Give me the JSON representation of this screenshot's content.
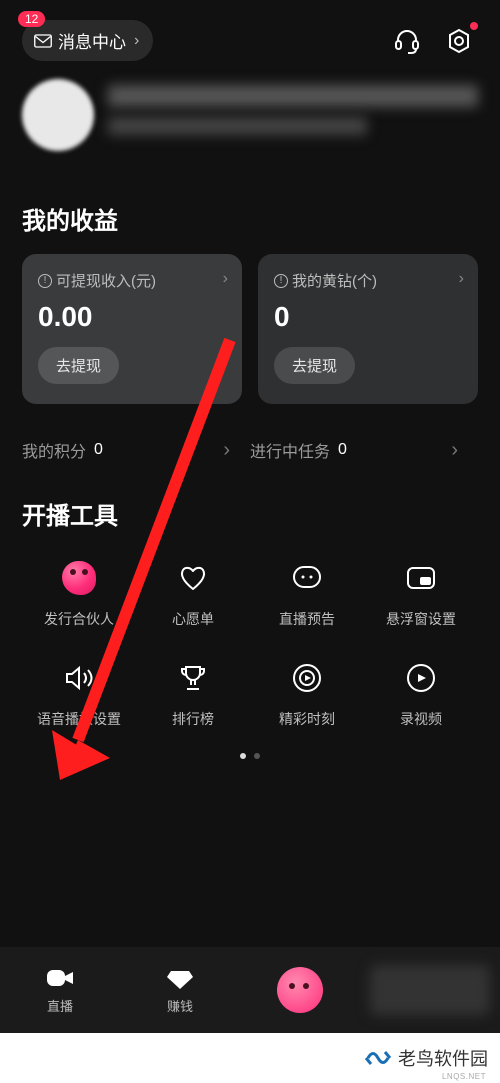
{
  "header": {
    "badge_count": "12",
    "message_center_label": "消息中心"
  },
  "earnings": {
    "title": "我的收益",
    "card1": {
      "label": "可提现收入(元)",
      "value": "0.00",
      "button": "去提现"
    },
    "card2": {
      "label": "我的黄钻(个)",
      "value": "0",
      "button": "去提现"
    },
    "stat1": {
      "label": "我的积分",
      "value": "0"
    },
    "stat2": {
      "label": "进行中任务",
      "value": "0"
    }
  },
  "tools": {
    "title": "开播工具",
    "items": [
      {
        "label": "发行合伙人"
      },
      {
        "label": "心愿单"
      },
      {
        "label": "直播预告"
      },
      {
        "label": "悬浮窗设置"
      },
      {
        "label": "语音播报设置"
      },
      {
        "label": "排行榜"
      },
      {
        "label": "精彩时刻"
      },
      {
        "label": "录视频"
      }
    ]
  },
  "bottom_nav": {
    "live": "直播",
    "earn": "赚钱"
  },
  "footer": {
    "brand": "老鸟软件园",
    "sub": "LNQS.NET"
  }
}
